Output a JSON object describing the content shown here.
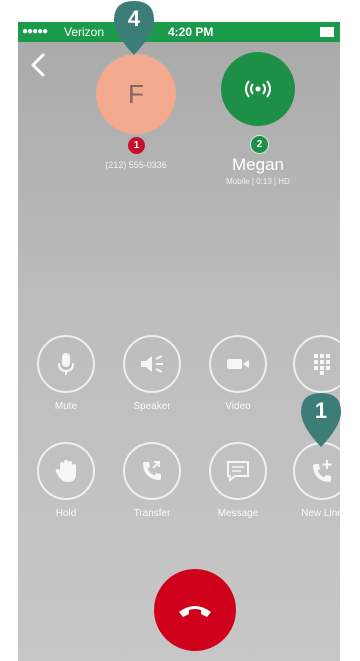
{
  "status_bar": {
    "signal": "●●●●●",
    "carrier": "Verizon",
    "time": "4:20 PM"
  },
  "callers": [
    {
      "initial": "F",
      "badge": "1",
      "number": "(212) 555-0336"
    },
    {
      "name": "Megan",
      "badge": "2",
      "detail": "Mobile | 0:13 | HD"
    }
  ],
  "controls_row1": [
    {
      "label": "Mute",
      "icon": "microphone-icon"
    },
    {
      "label": "Speaker",
      "icon": "speaker-icon"
    },
    {
      "label": "Video",
      "icon": "video-camera-icon"
    },
    {
      "label": "",
      "icon": "keypad-icon"
    }
  ],
  "controls_row2": [
    {
      "label": "Hold",
      "icon": "hand-icon"
    },
    {
      "label": "Transfer",
      "icon": "transfer-call-icon"
    },
    {
      "label": "Message",
      "icon": "message-icon"
    },
    {
      "label": "New Line",
      "icon": "add-call-icon"
    }
  ],
  "callouts": [
    {
      "number": "4"
    },
    {
      "number": "1"
    }
  ],
  "colors": {
    "status_bar": "#1b9a4b",
    "avatar_f": "#f2a98e",
    "avatar_megan": "#1e8f47",
    "badge_red": "#c8102e",
    "end_call": "#d0021b",
    "callout_pin": "#3c7d78"
  }
}
